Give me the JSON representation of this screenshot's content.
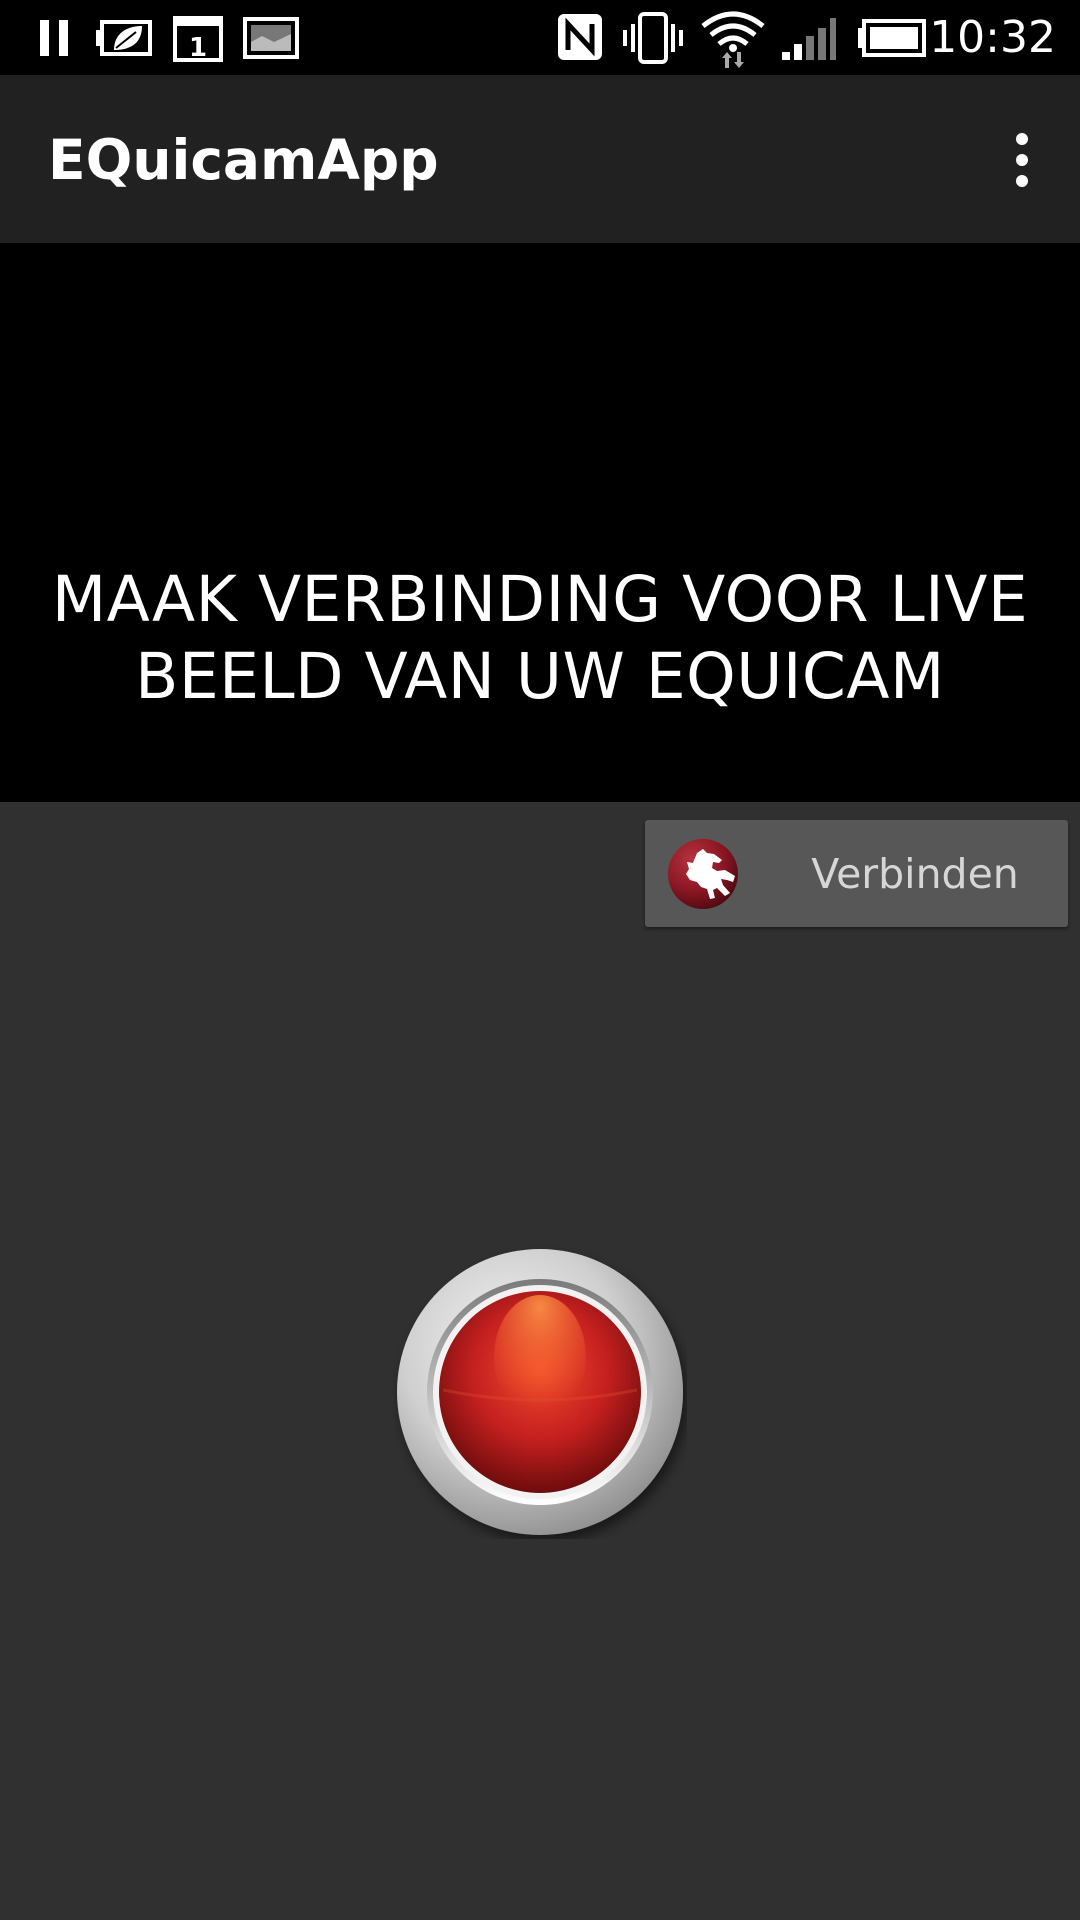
{
  "status_bar": {
    "time": "10:32",
    "icons": [
      "pause-icon",
      "battery-saver-icon",
      "calendar-icon",
      "gallery-icon",
      "nfc-icon",
      "vibrate-icon",
      "wifi-icon",
      "cell-signal-icon",
      "battery-icon"
    ],
    "calendar_day": "1"
  },
  "action_bar": {
    "title": "EQuicamApp",
    "menu_icon": "more-vert-icon"
  },
  "video": {
    "message": "MAAK VERBINDING VOOR LIVE BEELD VAN UW EQUICAM"
  },
  "connect": {
    "label": "Verbinden",
    "logo_icon": "horse-logo-icon"
  },
  "record": {
    "icon": "red-record-button-icon"
  },
  "colors": {
    "status_bar_bg": "#000000",
    "action_bar_bg": "#212121",
    "content_bg": "#303030",
    "video_bg": "#000000",
    "connect_button_bg": "#575757",
    "brand_red": "#8a1623",
    "record_red": "#c62020"
  }
}
